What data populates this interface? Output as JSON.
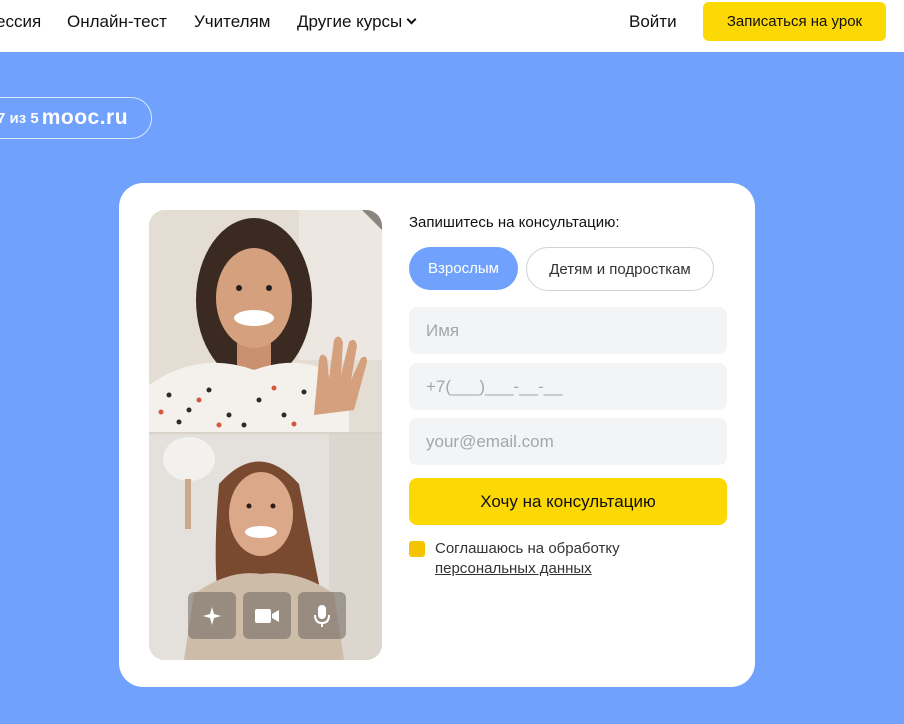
{
  "header": {
    "nav": [
      {
        "label": "ессия"
      },
      {
        "label": "Онлайн-тест"
      },
      {
        "label": "Учителям"
      },
      {
        "label": "Другие курсы"
      }
    ],
    "login_label": "Войти",
    "cta_label": "Записаться на урок"
  },
  "rating": {
    "text": "7 из 5",
    "brand": "mooc.ru"
  },
  "photo": {
    "controls": [
      "sparkle-icon",
      "video-camera-icon",
      "microphone-icon"
    ]
  },
  "form": {
    "title": "Запишитесь на консультацию:",
    "segments": {
      "adult": "Взрослым",
      "kids": "Детям и подросткам"
    },
    "name_placeholder": "Имя",
    "phone_placeholder": "+7(___)___-__-__",
    "email_placeholder": "your@email.com",
    "submit_label": "Хочу на консультацию",
    "consent_text": "Соглашаюсь на обработку",
    "consent_link": "персональных данных"
  },
  "colors": {
    "background": "#6fa1fd",
    "accent_yellow": "#fcd804",
    "accent_blue": "#6fa1fd"
  }
}
